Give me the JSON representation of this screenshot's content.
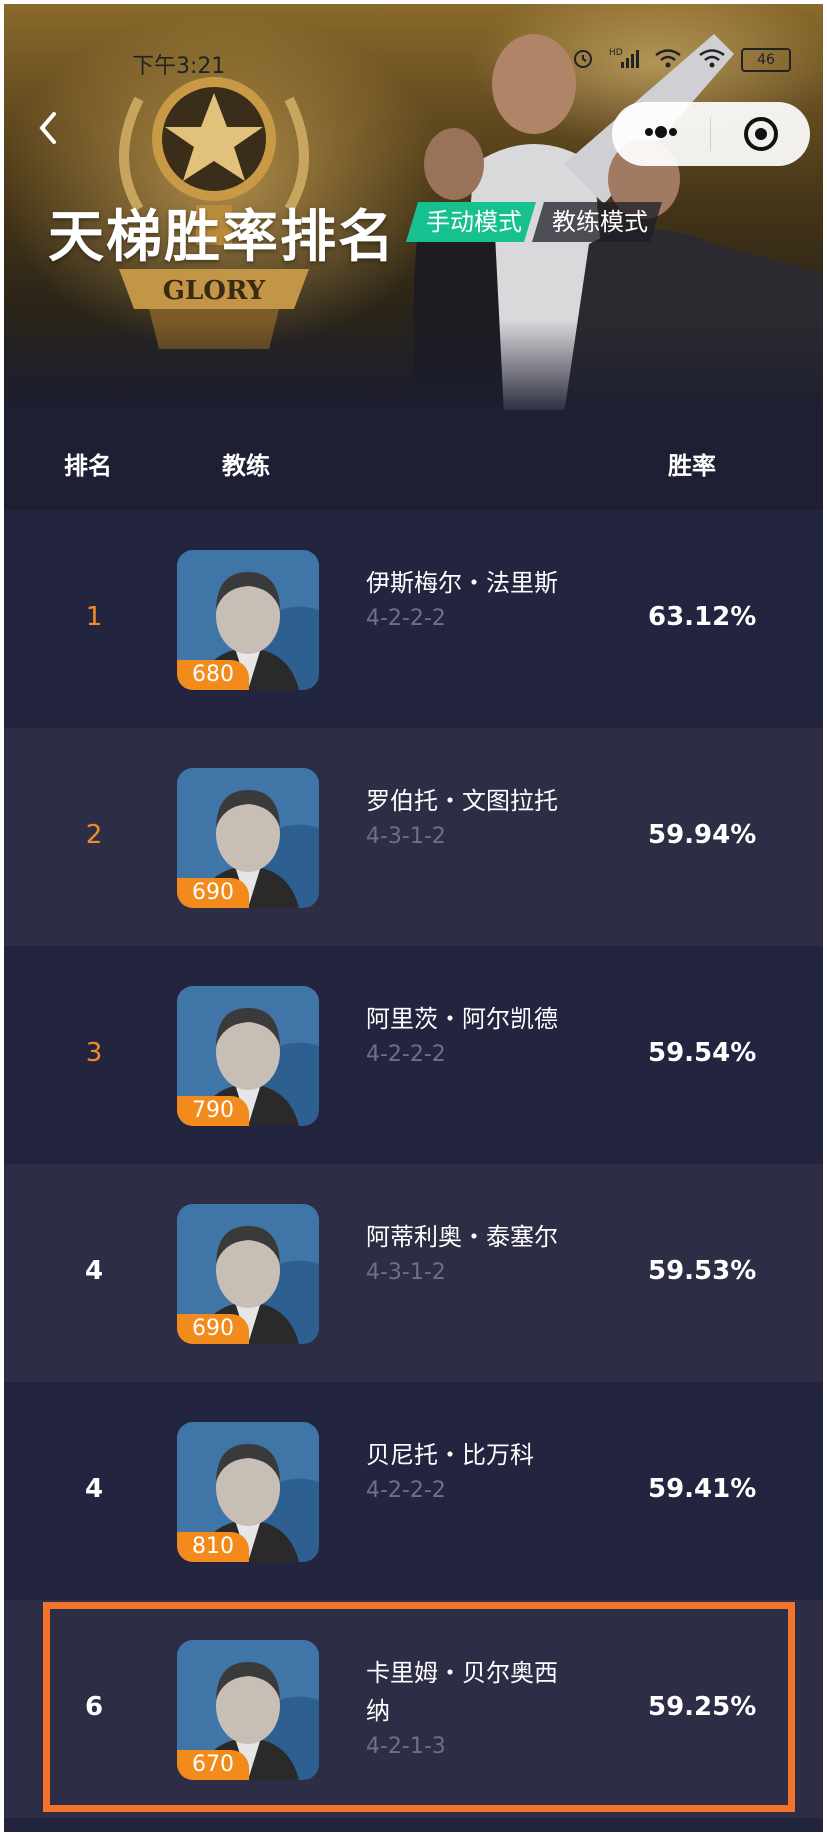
{
  "status_bar": {
    "time": "下午3:21",
    "network": "HD",
    "battery": "46"
  },
  "header": {
    "title": "天梯胜率排名",
    "trophy_text": "GLORY",
    "modes": [
      {
        "label": "手动模式",
        "active": true
      },
      {
        "label": "教练模式",
        "active": false
      }
    ]
  },
  "table": {
    "columns": {
      "rank": "排名",
      "coach": "教练",
      "win_rate": "胜率"
    },
    "rows": [
      {
        "rank": "1",
        "name": "伊斯梅尔・法里斯",
        "formation": "4-2-2-2",
        "rating": "680",
        "win_rate": "63.12%"
      },
      {
        "rank": "2",
        "name": "罗伯托・文图拉托",
        "formation": "4-3-1-2",
        "rating": "690",
        "win_rate": "59.94%"
      },
      {
        "rank": "3",
        "name": "阿里茨・阿尔凯德",
        "formation": "4-2-2-2",
        "rating": "790",
        "win_rate": "59.54%"
      },
      {
        "rank": "4",
        "name": "阿蒂利奥・泰塞尔",
        "formation": "4-3-1-2",
        "rating": "690",
        "win_rate": "59.53%"
      },
      {
        "rank": "4",
        "name": "贝尼托・比万科",
        "formation": "4-2-2-2",
        "rating": "810",
        "win_rate": "59.41%"
      },
      {
        "rank": "6",
        "name": "卡里姆・贝尔奥西纳",
        "formation": "4-2-1-3",
        "rating": "670",
        "win_rate": "59.25%"
      }
    ]
  },
  "colors": {
    "accent_green": "#17c08f",
    "rank_gold": "#f08c2a",
    "rating_orange": "#f28a1c",
    "highlight_border": "#f4732a",
    "row_dark": "#232440",
    "row_light": "#2d2e46"
  }
}
